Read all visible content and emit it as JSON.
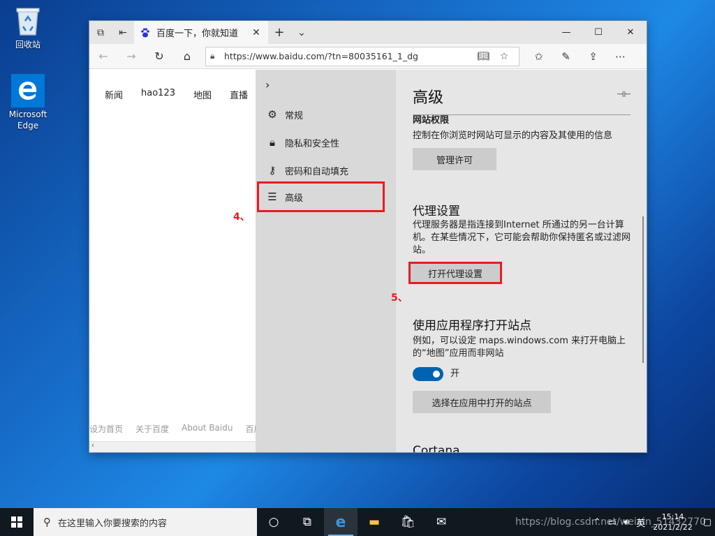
{
  "desktop": {
    "icons": [
      {
        "label": "回收站"
      },
      {
        "label": "Microsoft Edge"
      }
    ]
  },
  "browser": {
    "tab": {
      "title": "百度一下，你就知道"
    },
    "window_controls": {
      "minimize": "—",
      "maximize": "☐",
      "close": "✕"
    },
    "address": {
      "url": "https://www.baidu.com/?tn=80035161_1_dg"
    },
    "page": {
      "nav": [
        "新闻",
        "hao123",
        "地图",
        "直播"
      ],
      "footer": [
        "设为首页",
        "关于百度",
        "About Baidu",
        "百度"
      ]
    }
  },
  "settings": {
    "menu": [
      {
        "label": "常规",
        "icon": "gear-icon"
      },
      {
        "label": "隐私和安全性",
        "icon": "lock-icon"
      },
      {
        "label": "密码和自动填充",
        "icon": "key-icon"
      },
      {
        "label": "高级",
        "icon": "sliders-icon"
      }
    ],
    "annotation_4": "4、",
    "annotation_5": "5、",
    "title": "高级",
    "site_perm": {
      "heading": "网站权限",
      "desc": "控制在你浏览时网站可显示的内容及其使用的信息",
      "button": "管理许可"
    },
    "proxy": {
      "heading": "代理设置",
      "desc": "代理服务器是指连接到Internet 所通过的另一台计算机。在某些情况下，它可能会帮助你保持匿名或过滤网站。",
      "button": "打开代理设置"
    },
    "apps": {
      "heading": "使用应用程序打开站点",
      "desc": "例如，可以设定 maps.windows.com 来打开电脑上的“地图”应用而非网站",
      "toggle_state": "开",
      "button": "选择在应用中打开的站点"
    },
    "cortana": {
      "heading": "Cortana"
    }
  },
  "taskbar": {
    "search_placeholder": "在这里输入你要搜索的内容",
    "ime": "英",
    "time": "15:14",
    "date": "2021/2/22"
  },
  "watermark": "https://blog.csdn.net/weixin_51432770"
}
